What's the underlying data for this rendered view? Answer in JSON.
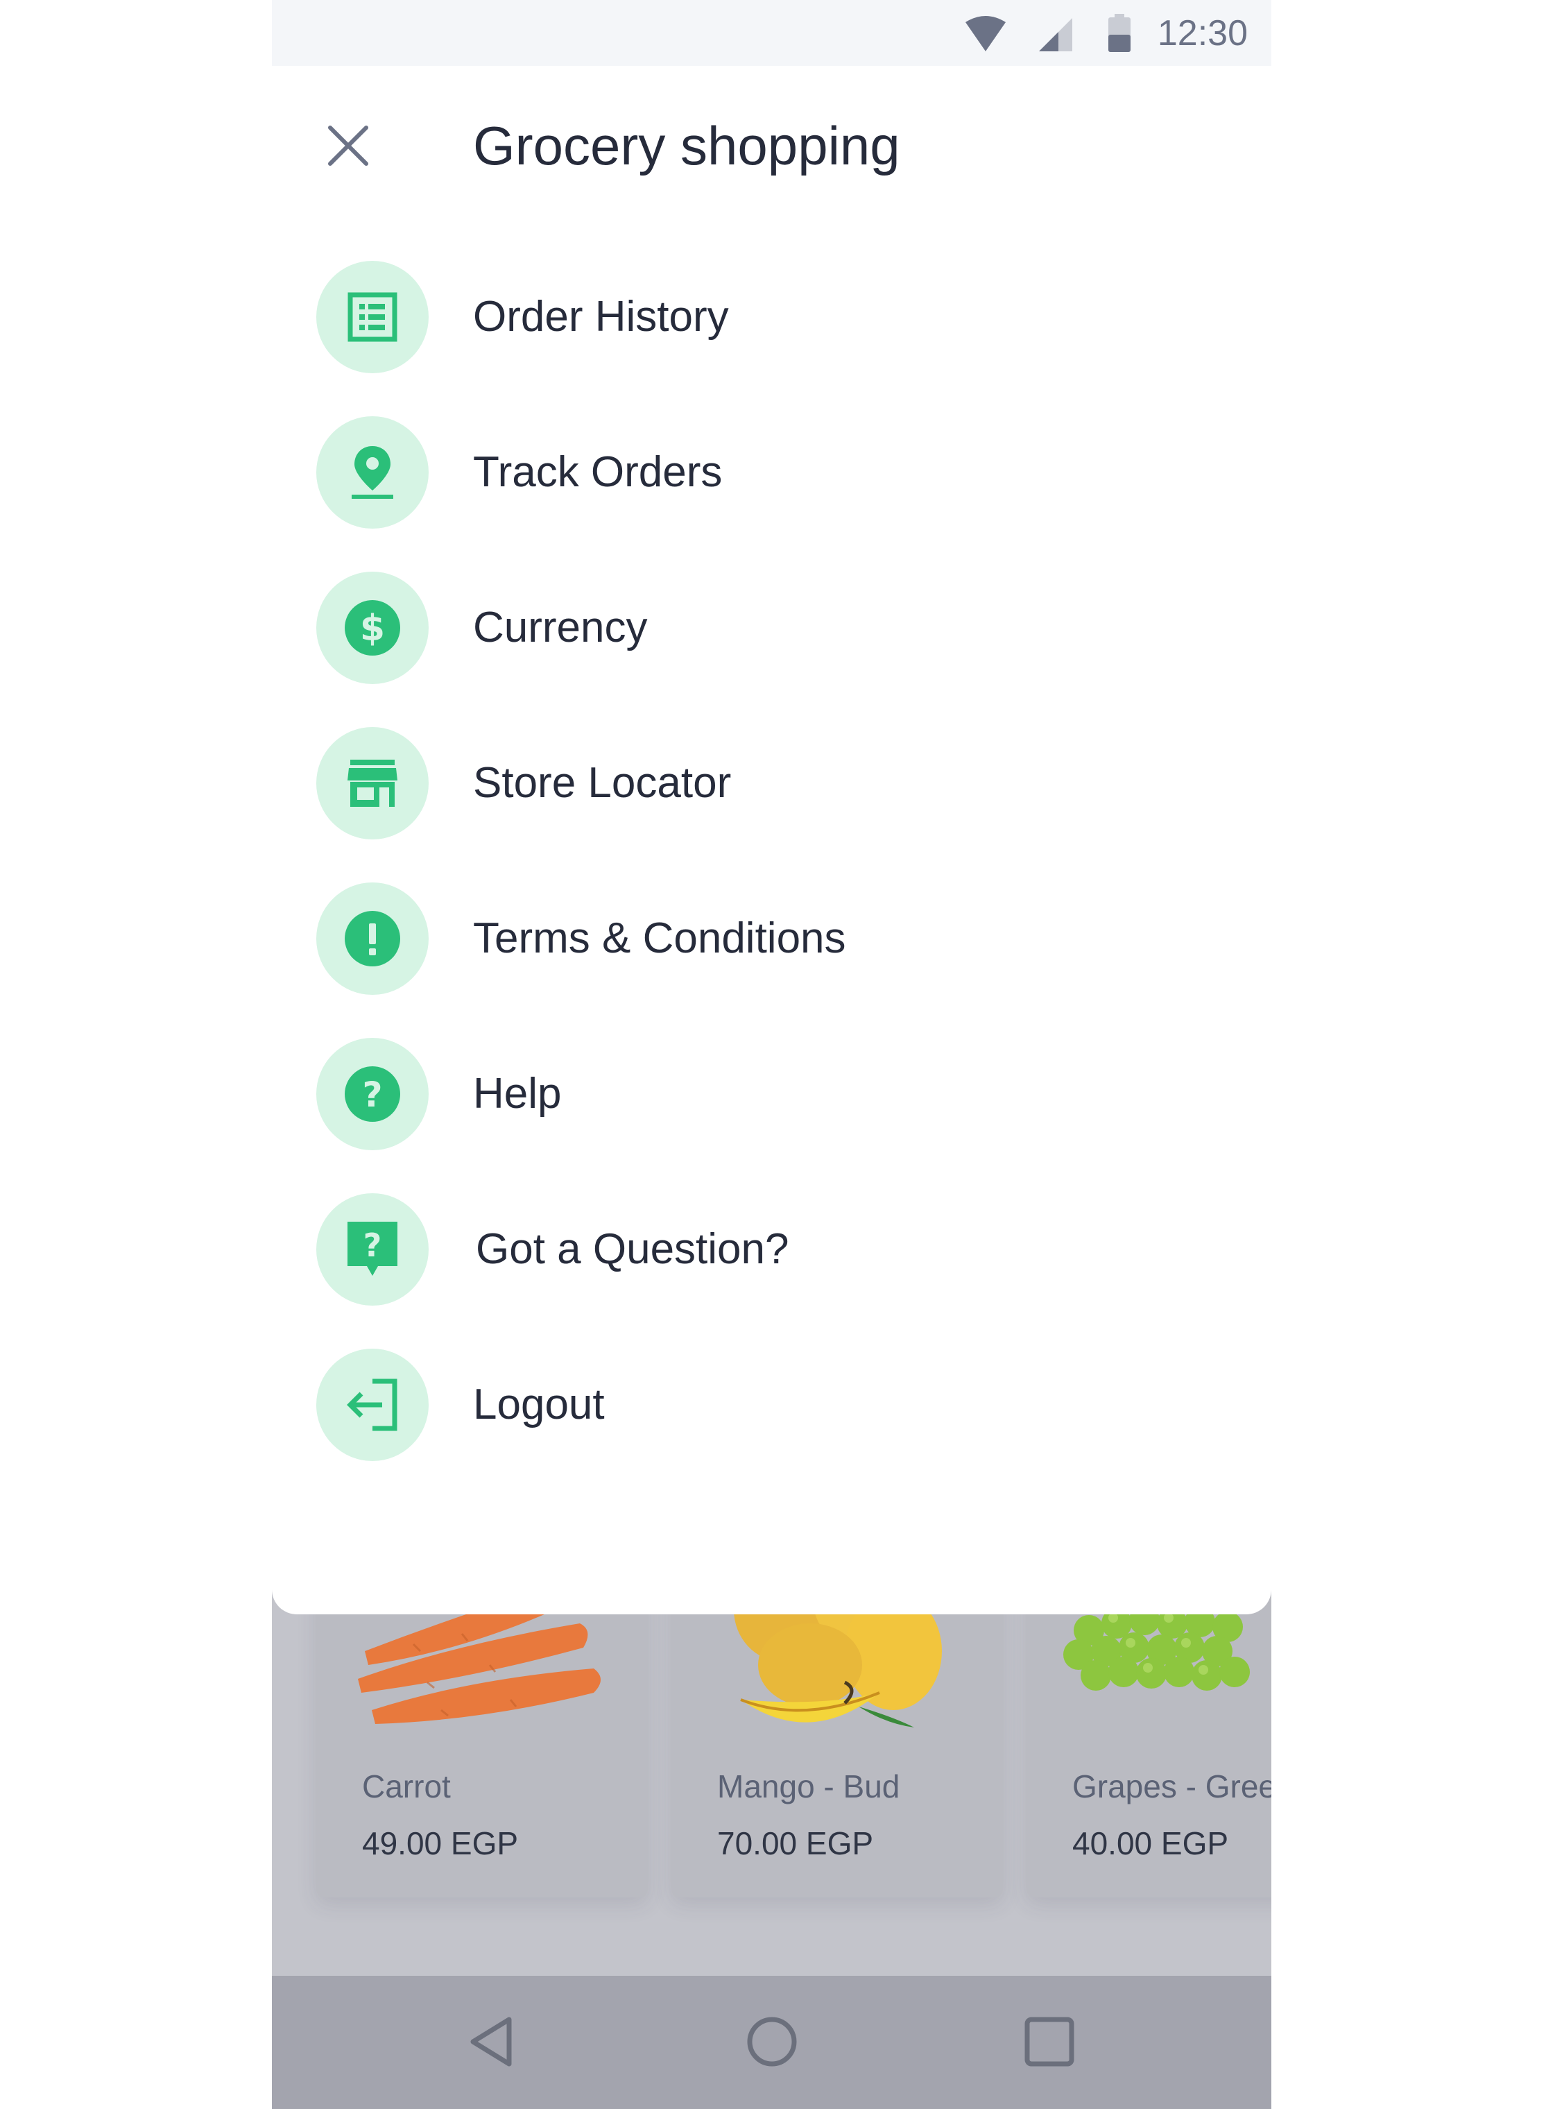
{
  "status_bar": {
    "time": "12:30"
  },
  "drawer": {
    "title": "Grocery shopping",
    "items": [
      {
        "label": "Order History",
        "icon": "list-icon"
      },
      {
        "label": "Track Orders",
        "icon": "location-pin-icon"
      },
      {
        "label": "Currency",
        "icon": "dollar-icon"
      },
      {
        "label": "Store Locator",
        "icon": "store-icon"
      },
      {
        "label": "Terms & Conditions",
        "icon": "alert-icon"
      },
      {
        "label": "Help",
        "icon": "help-icon"
      },
      {
        "label": "Got a Question?",
        "icon": "question-bubble-icon"
      },
      {
        "label": "Logout",
        "icon": "logout-icon"
      }
    ]
  },
  "products": [
    {
      "name": "Carrot",
      "price": "49.00 EGP"
    },
    {
      "name": "Mango - Bud",
      "price": "70.00 EGP"
    },
    {
      "name": "Grapes - Gree",
      "price": "40.00 EGP"
    }
  ],
  "colors": {
    "accent": "#2bbf79",
    "icon_bg": "#d6f4e4",
    "text": "#262b3b"
  }
}
